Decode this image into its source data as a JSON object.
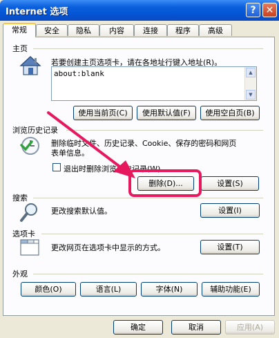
{
  "window": {
    "title": "Internet 选项",
    "help_label": "?",
    "close_label": "✕"
  },
  "tabs": [
    {
      "label": "常规",
      "active": true
    },
    {
      "label": "安全"
    },
    {
      "label": "隐私"
    },
    {
      "label": "内容"
    },
    {
      "label": "连接"
    },
    {
      "label": "程序"
    },
    {
      "label": "高级"
    }
  ],
  "homepage": {
    "section_label": "主页",
    "description": "若要创建主页选项卡，请在各地址行键入地址(R)。",
    "url_value": "about:blank",
    "buttons": {
      "use_current": "使用当前页(C)",
      "use_default": "使用默认值(F)",
      "use_blank": "使用空白页(B)"
    },
    "icon": "house-icon"
  },
  "history": {
    "section_label": "浏览历史记录",
    "description_line1": "删除临时文件、历史记录、Cookie、保存的密码和网页",
    "description_line2": "表单信息。",
    "checkbox_label": "退出时删除浏览历史记录(W)",
    "checkbox_checked": false,
    "buttons": {
      "delete": "删除(D)...",
      "settings": "设置(S)"
    },
    "icon": "clock-check-icon"
  },
  "search": {
    "section_label": "搜索",
    "description": "更改搜索默认值。",
    "settings_button": "设置(I)",
    "icon": "magnifier-icon"
  },
  "tabs_section": {
    "section_label": "选项卡",
    "description": "更改网页在选项卡中显示的方式。",
    "settings_button": "设置(T)",
    "icon": "tabbed-window-icon"
  },
  "appearance": {
    "section_label": "外观",
    "buttons": {
      "colors": "颜色(O)",
      "languages": "语言(L)",
      "fonts": "字体(N)",
      "accessibility": "辅助功能(E)"
    }
  },
  "footer": {
    "ok": "确定",
    "cancel": "取消",
    "apply": "应用(A)"
  },
  "annotation": {
    "arrow_color": "#e6195f",
    "highlight_color": "#e6195f"
  },
  "colors": {
    "titlebar": "#0454d3",
    "dialog_bg": "#ece9d8",
    "tab_highlight": "#ffc83c"
  }
}
